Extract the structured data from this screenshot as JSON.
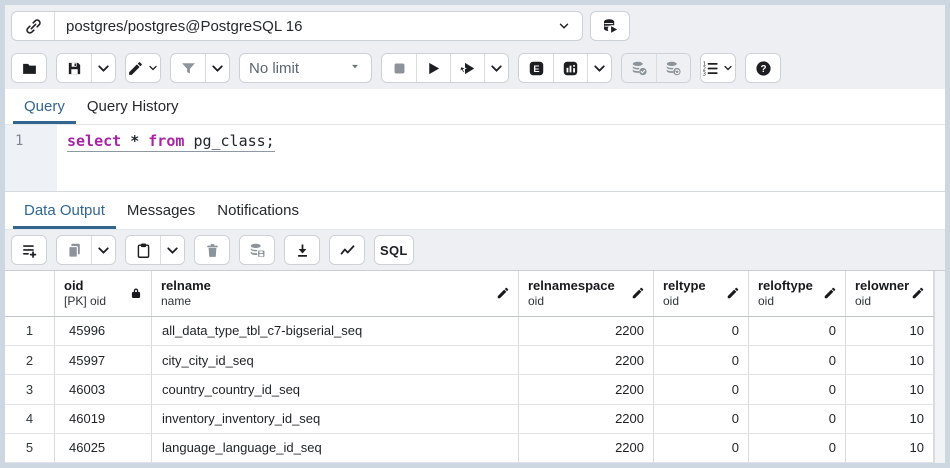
{
  "connection_bar": {
    "connection_label": "postgres/postgres@PostgreSQL 16"
  },
  "main_toolbar": {
    "groups": [
      {
        "buttons": [
          {
            "name": "open-file",
            "icon": "folder"
          }
        ]
      },
      {
        "buttons": [
          {
            "name": "save-file",
            "icon": "save"
          },
          {
            "name": "save-options",
            "icon": "chevron-down",
            "narrow": true
          }
        ]
      },
      {
        "buttons": [
          {
            "name": "edit",
            "icon": "pencil",
            "chevron": true
          }
        ]
      },
      {
        "buttons": [
          {
            "name": "filter",
            "icon": "filter",
            "disabled": true
          },
          {
            "name": "filter-options",
            "icon": "chevron-down",
            "narrow": true
          }
        ]
      },
      {
        "select": {
          "name": "row-limit",
          "value": "No limit"
        }
      },
      {
        "buttons": [
          {
            "name": "cancel-query",
            "icon": "stop",
            "disabled": true
          },
          {
            "name": "execute-query",
            "icon": "play"
          },
          {
            "name": "execute-from-cursor",
            "icon": "play-cursor"
          },
          {
            "name": "execute-options",
            "icon": "chevron-down",
            "narrow": true
          }
        ]
      },
      {
        "buttons": [
          {
            "name": "explain",
            "icon": "explain-e"
          },
          {
            "name": "explain-analyze",
            "icon": "explain-analyze"
          },
          {
            "name": "explain-options",
            "icon": "chevron-down",
            "narrow": true
          }
        ]
      },
      {
        "muted": true,
        "buttons": [
          {
            "name": "commit",
            "icon": "db-commit",
            "disabled": true
          },
          {
            "name": "rollback",
            "icon": "db-rollback",
            "disabled": true
          }
        ]
      },
      {
        "buttons": [
          {
            "name": "macros",
            "icon": "ordered-list",
            "chevron": true
          }
        ]
      },
      {
        "buttons": [
          {
            "name": "help",
            "icon": "help"
          }
        ]
      }
    ]
  },
  "editor_tabs": {
    "tabs": [
      {
        "label": "Query",
        "active": true
      },
      {
        "label": "Query History",
        "active": false
      }
    ]
  },
  "editor": {
    "line_number": "1",
    "sql_tokens": [
      {
        "text": "select",
        "type": "keyword"
      },
      {
        "text": " ",
        "type": "plain"
      },
      {
        "text": "*",
        "type": "operator"
      },
      {
        "text": " ",
        "type": "plain"
      },
      {
        "text": "from",
        "type": "keyword"
      },
      {
        "text": " ",
        "type": "plain"
      },
      {
        "text": "pg_class;",
        "type": "plain"
      }
    ]
  },
  "output_tabs": {
    "tabs": [
      {
        "label": "Data Output",
        "active": true
      },
      {
        "label": "Messages",
        "active": false
      },
      {
        "label": "Notifications",
        "active": false
      }
    ]
  },
  "output_toolbar": {
    "groups": [
      {
        "buttons": [
          {
            "name": "add-row",
            "icon": "add-row"
          }
        ]
      },
      {
        "buttons": [
          {
            "name": "copy",
            "icon": "copy",
            "disabled": true
          },
          {
            "name": "copy-options",
            "icon": "chevron-down",
            "narrow": true
          }
        ]
      },
      {
        "buttons": [
          {
            "name": "paste",
            "icon": "paste"
          },
          {
            "name": "paste-options",
            "icon": "chevron-down",
            "narrow": true
          }
        ]
      },
      {
        "buttons": [
          {
            "name": "delete-row",
            "icon": "trash",
            "disabled": true
          }
        ]
      },
      {
        "buttons": [
          {
            "name": "save-data-changes",
            "icon": "db-save",
            "disabled": true
          }
        ]
      },
      {
        "buttons": [
          {
            "name": "download-results",
            "icon": "download"
          }
        ]
      },
      {
        "buttons": [
          {
            "name": "graph-visualiser",
            "icon": "chart-line"
          }
        ]
      },
      {
        "buttons": [
          {
            "name": "sql-filter",
            "label": "SQL"
          }
        ]
      }
    ]
  },
  "grid": {
    "columns": [
      {
        "name": "oid",
        "type": "[PK] oid",
        "icon": "lock",
        "align": "al-pad"
      },
      {
        "name": "relname",
        "type": "name",
        "icon": "pencil-small",
        "align": "al"
      },
      {
        "name": "relnamespace",
        "type": "oid",
        "icon": "pencil-small",
        "align": "ar"
      },
      {
        "name": "reltype",
        "type": "oid",
        "icon": "pencil-small",
        "align": "ar"
      },
      {
        "name": "reloftype",
        "type": "oid",
        "icon": "pencil-small",
        "align": "ar"
      },
      {
        "name": "relowner",
        "type": "oid",
        "icon": "pencil-small",
        "align": "ar"
      }
    ],
    "rows": [
      {
        "num": "1",
        "cells": [
          "45996",
          "all_data_type_tbl_c7-bigserial_seq",
          "2200",
          "0",
          "0",
          "10"
        ]
      },
      {
        "num": "2",
        "cells": [
          "45997",
          "city_city_id_seq",
          "2200",
          "0",
          "0",
          "10"
        ]
      },
      {
        "num": "3",
        "cells": [
          "46003",
          "country_country_id_seq",
          "2200",
          "0",
          "0",
          "10"
        ]
      },
      {
        "num": "4",
        "cells": [
          "46019",
          "inventory_inventory_id_seq",
          "2200",
          "0",
          "0",
          "10"
        ]
      },
      {
        "num": "5",
        "cells": [
          "46025",
          "language_language_id_seq",
          "2200",
          "0",
          "0",
          "10"
        ]
      }
    ]
  },
  "colors": {
    "accent": "#326690",
    "keyword": "#a626a4",
    "icon": "#1c1e21",
    "disabled_icon": "#8d939b",
    "toolbar_bg": "#edeff3",
    "frame_border": "#ccd7e2"
  }
}
